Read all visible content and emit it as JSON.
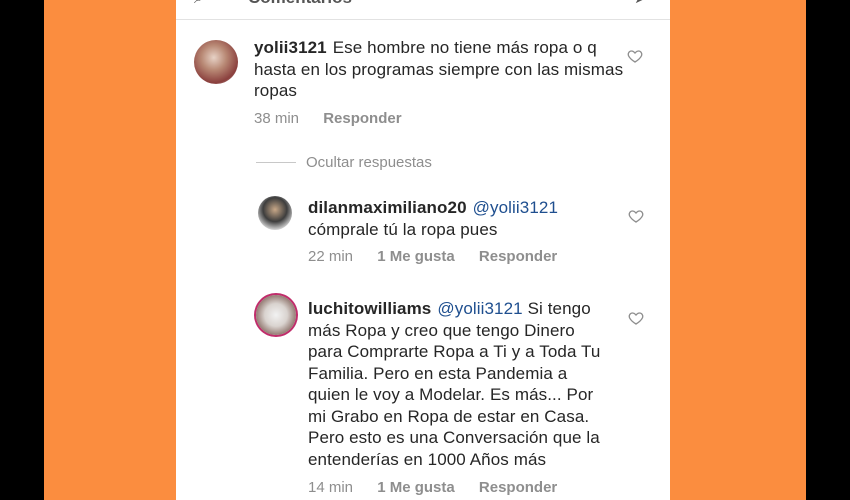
{
  "header": {
    "cut_text": "Comentarios"
  },
  "comments": [
    {
      "user": "yolii3121",
      "mention": "",
      "text": "Ese hombre no tiene más ropa o q hasta en los programas siempre con las mismas ropas",
      "time": "38 min",
      "likes": "",
      "reply": "Responder"
    },
    {
      "user": "dilanmaximiliano20",
      "mention": "@yolii3121",
      "text": "cómprale tú  la ropa pues",
      "time": "22 min",
      "likes": "1 Me gusta",
      "reply": "Responder"
    },
    {
      "user": "luchitowilliams",
      "mention": "@yolii3121",
      "text": "Si tengo más Ropa y creo que tengo Dinero para Comprarte Ropa a Ti y a Toda Tu Familia. Pero en esta Pandemia a quien le voy a Modelar. Es más... Por mi Grabo en Ropa de estar en Casa. Pero esto es una Conversación que la entenderías  en 1000 Años más",
      "time": "14 min",
      "likes": "1 Me gusta",
      "reply": "Responder"
    }
  ],
  "hide_replies": "Ocultar respuestas",
  "colors": {
    "frame": "#fb8d3f",
    "mention": "#1f4f8f",
    "meta": "#8e8e8e"
  }
}
